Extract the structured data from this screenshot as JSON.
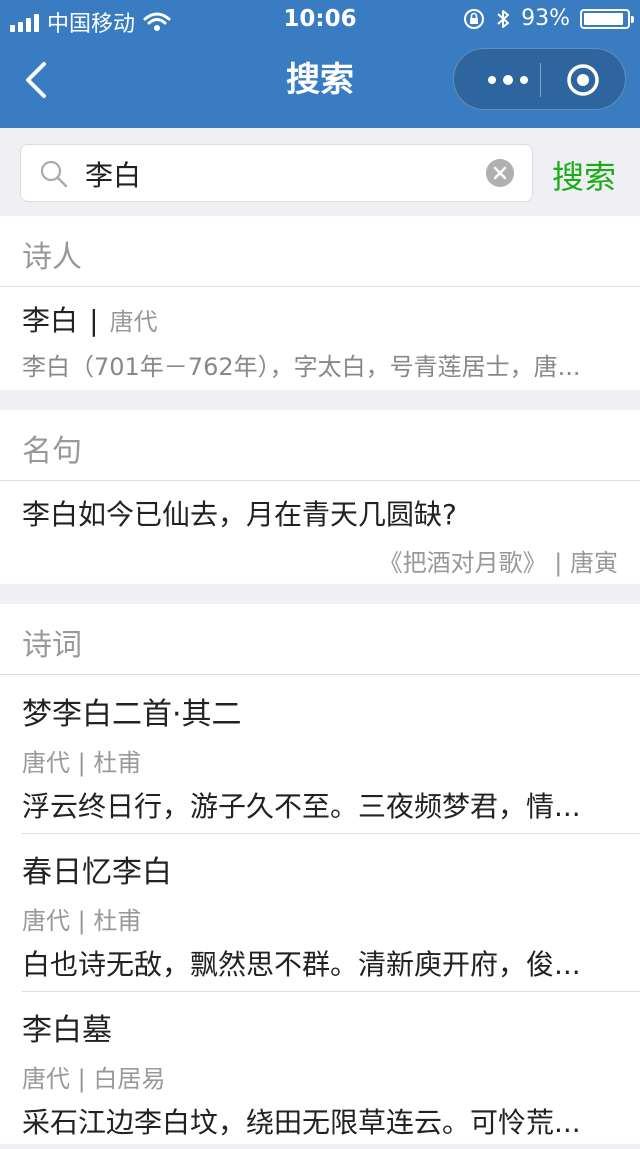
{
  "status": {
    "carrier": "中国移动",
    "time": "10:06",
    "battery": "93%",
    "battery_level": 0.93
  },
  "nav": {
    "title": "搜索"
  },
  "search": {
    "value": "李白",
    "button": "搜索"
  },
  "poets": {
    "title": "诗人",
    "items": [
      {
        "name": "李白",
        "sep": "|",
        "dynasty": "唐代",
        "desc": "李白（701年－762年），字太白，号青莲居士，唐..."
      }
    ]
  },
  "quotes": {
    "title": "名句",
    "items": [
      {
        "text": "李白如今已仙去，月在青天几圆缺?",
        "source": "《把酒对月歌》 | 唐寅"
      }
    ]
  },
  "poems": {
    "title": "诗词",
    "items": [
      {
        "title": "梦李白二首·其二",
        "meta": "唐代 | 杜甫",
        "line": "浮云终日行，游子久不至。三夜频梦君，情..."
      },
      {
        "title": "春日忆李白",
        "meta": "唐代 | 杜甫",
        "line": "白也诗无敌，飘然思不群。清新庾开府，俊..."
      },
      {
        "title": "李白墓",
        "meta": "唐代 | 白居易",
        "line": "采石江边李白坟，绕田无限草连云。可怜荒..."
      }
    ]
  }
}
